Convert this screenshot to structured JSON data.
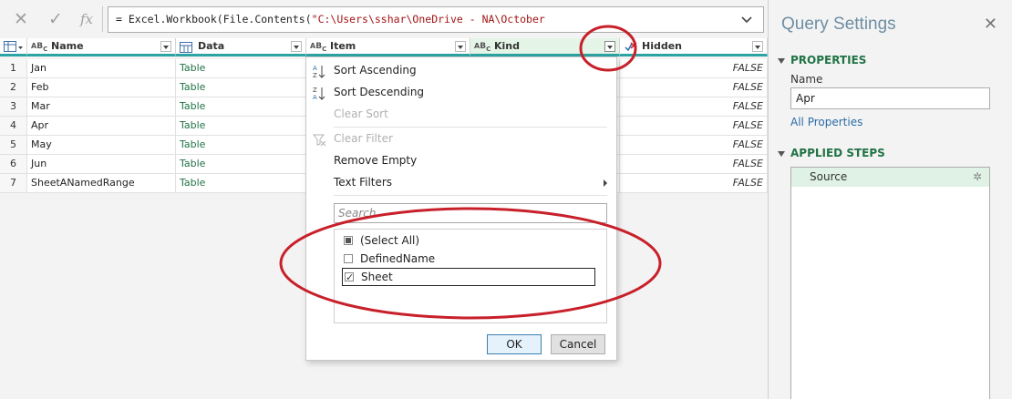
{
  "formula_bar": {
    "cancel_icon": "x-icon",
    "commit_icon": "check-icon",
    "fx_label": "fx",
    "formula_prefix": "= Excel.Workbook(File.Contents(",
    "formula_string": "\"C:\\Users\\sshar\\OneDrive - NA\\October"
  },
  "grid": {
    "columns": [
      {
        "type_icon": "ABC",
        "name": "Name"
      },
      {
        "type_icon": "table-icon",
        "name": "Data"
      },
      {
        "type_icon": "ABC",
        "name": "Item"
      },
      {
        "type_icon": "ABC",
        "name": "Kind"
      },
      {
        "type_icon": "boolean-icon",
        "name": "Hidden"
      }
    ],
    "rows": [
      {
        "n": "1",
        "name": "Jan",
        "data": "Table",
        "hidden": "FALSE"
      },
      {
        "n": "2",
        "name": "Feb",
        "data": "Table",
        "hidden": "FALSE"
      },
      {
        "n": "3",
        "name": "Mar",
        "data": "Table",
        "hidden": "FALSE"
      },
      {
        "n": "4",
        "name": "Apr",
        "data": "Table",
        "hidden": "FALSE"
      },
      {
        "n": "5",
        "name": "May",
        "data": "Table",
        "hidden": "FALSE"
      },
      {
        "n": "6",
        "name": "Jun",
        "data": "Table",
        "hidden": "FALSE"
      },
      {
        "n": "7",
        "name": "SheetANamedRange",
        "data": "Table",
        "hidden": "FALSE"
      }
    ]
  },
  "filter_menu": {
    "sort_asc": "Sort Ascending",
    "sort_desc": "Sort Descending",
    "clear_sort": "Clear Sort",
    "clear_filter": "Clear Filter",
    "remove_empty": "Remove Empty",
    "text_filters": "Text Filters",
    "search_placeholder": "Search",
    "items": [
      {
        "label": "(Select All)",
        "state": "partial"
      },
      {
        "label": "DefinedName",
        "state": "unchecked"
      },
      {
        "label": "Sheet",
        "state": "checked"
      }
    ],
    "ok_label": "OK",
    "cancel_label": "Cancel"
  },
  "query_settings": {
    "title": "Query Settings",
    "properties_header": "PROPERTIES",
    "name_label": "Name",
    "name_value": "Apr",
    "all_properties_link": "All Properties",
    "applied_steps_header": "APPLIED STEPS",
    "steps": [
      {
        "label": "Source"
      }
    ]
  },
  "colors": {
    "accent_teal": "#2ea3a3",
    "annotation_red": "#c8202a",
    "section_green": "#217346"
  }
}
